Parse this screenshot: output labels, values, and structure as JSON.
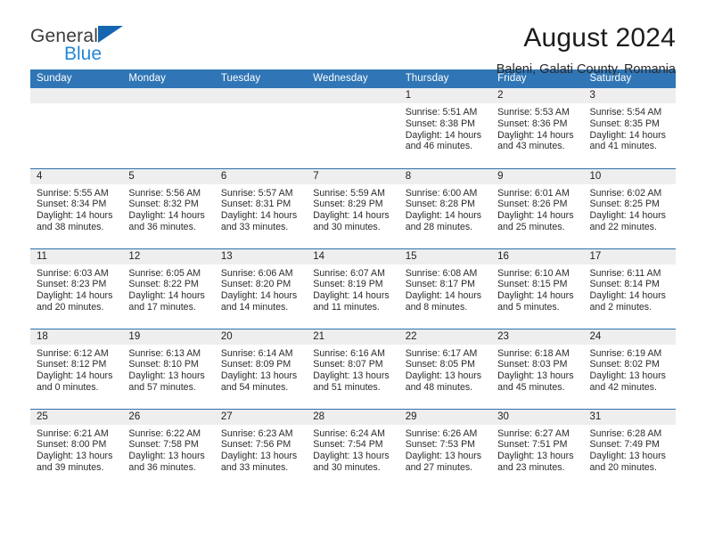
{
  "brand": {
    "line1": "General",
    "line2": "Blue",
    "triangle_color": "#1565b0",
    "line2_color": "#2287d6",
    "logo_icon": "general-blue-logo"
  },
  "header": {
    "title": "August 2024",
    "subtitle": "Baleni, Galati County, Romania"
  },
  "theme": {
    "header_blue": "#3076b6",
    "row_divider_blue": "#2f6fab",
    "daynum_band_grey": "#eeeeee",
    "text": "#2b2b2b"
  },
  "columns": [
    "Sunday",
    "Monday",
    "Tuesday",
    "Wednesday",
    "Thursday",
    "Friday",
    "Saturday"
  ],
  "labels": {
    "sunrise_prefix": "Sunrise:",
    "sunset_prefix": "Sunset:",
    "daylight_prefix": "Daylight:"
  },
  "weeks": [
    [
      {
        "day": "",
        "empty": true
      },
      {
        "day": "",
        "empty": true
      },
      {
        "day": "",
        "empty": true
      },
      {
        "day": "",
        "empty": true
      },
      {
        "day": "1",
        "sunrise": "Sunrise: 5:51 AM",
        "sunset": "Sunset: 8:38 PM",
        "daylight": "Daylight: 14 hours and 46 minutes."
      },
      {
        "day": "2",
        "sunrise": "Sunrise: 5:53 AM",
        "sunset": "Sunset: 8:36 PM",
        "daylight": "Daylight: 14 hours and 43 minutes."
      },
      {
        "day": "3",
        "sunrise": "Sunrise: 5:54 AM",
        "sunset": "Sunset: 8:35 PM",
        "daylight": "Daylight: 14 hours and 41 minutes."
      }
    ],
    [
      {
        "day": "4",
        "sunrise": "Sunrise: 5:55 AM",
        "sunset": "Sunset: 8:34 PM",
        "daylight": "Daylight: 14 hours and 38 minutes."
      },
      {
        "day": "5",
        "sunrise": "Sunrise: 5:56 AM",
        "sunset": "Sunset: 8:32 PM",
        "daylight": "Daylight: 14 hours and 36 minutes."
      },
      {
        "day": "6",
        "sunrise": "Sunrise: 5:57 AM",
        "sunset": "Sunset: 8:31 PM",
        "daylight": "Daylight: 14 hours and 33 minutes."
      },
      {
        "day": "7",
        "sunrise": "Sunrise: 5:59 AM",
        "sunset": "Sunset: 8:29 PM",
        "daylight": "Daylight: 14 hours and 30 minutes."
      },
      {
        "day": "8",
        "sunrise": "Sunrise: 6:00 AM",
        "sunset": "Sunset: 8:28 PM",
        "daylight": "Daylight: 14 hours and 28 minutes."
      },
      {
        "day": "9",
        "sunrise": "Sunrise: 6:01 AM",
        "sunset": "Sunset: 8:26 PM",
        "daylight": "Daylight: 14 hours and 25 minutes."
      },
      {
        "day": "10",
        "sunrise": "Sunrise: 6:02 AM",
        "sunset": "Sunset: 8:25 PM",
        "daylight": "Daylight: 14 hours and 22 minutes."
      }
    ],
    [
      {
        "day": "11",
        "sunrise": "Sunrise: 6:03 AM",
        "sunset": "Sunset: 8:23 PM",
        "daylight": "Daylight: 14 hours and 20 minutes."
      },
      {
        "day": "12",
        "sunrise": "Sunrise: 6:05 AM",
        "sunset": "Sunset: 8:22 PM",
        "daylight": "Daylight: 14 hours and 17 minutes."
      },
      {
        "day": "13",
        "sunrise": "Sunrise: 6:06 AM",
        "sunset": "Sunset: 8:20 PM",
        "daylight": "Daylight: 14 hours and 14 minutes."
      },
      {
        "day": "14",
        "sunrise": "Sunrise: 6:07 AM",
        "sunset": "Sunset: 8:19 PM",
        "daylight": "Daylight: 14 hours and 11 minutes."
      },
      {
        "day": "15",
        "sunrise": "Sunrise: 6:08 AM",
        "sunset": "Sunset: 8:17 PM",
        "daylight": "Daylight: 14 hours and 8 minutes."
      },
      {
        "day": "16",
        "sunrise": "Sunrise: 6:10 AM",
        "sunset": "Sunset: 8:15 PM",
        "daylight": "Daylight: 14 hours and 5 minutes."
      },
      {
        "day": "17",
        "sunrise": "Sunrise: 6:11 AM",
        "sunset": "Sunset: 8:14 PM",
        "daylight": "Daylight: 14 hours and 2 minutes."
      }
    ],
    [
      {
        "day": "18",
        "sunrise": "Sunrise: 6:12 AM",
        "sunset": "Sunset: 8:12 PM",
        "daylight": "Daylight: 14 hours and 0 minutes."
      },
      {
        "day": "19",
        "sunrise": "Sunrise: 6:13 AM",
        "sunset": "Sunset: 8:10 PM",
        "daylight": "Daylight: 13 hours and 57 minutes."
      },
      {
        "day": "20",
        "sunrise": "Sunrise: 6:14 AM",
        "sunset": "Sunset: 8:09 PM",
        "daylight": "Daylight: 13 hours and 54 minutes."
      },
      {
        "day": "21",
        "sunrise": "Sunrise: 6:16 AM",
        "sunset": "Sunset: 8:07 PM",
        "daylight": "Daylight: 13 hours and 51 minutes."
      },
      {
        "day": "22",
        "sunrise": "Sunrise: 6:17 AM",
        "sunset": "Sunset: 8:05 PM",
        "daylight": "Daylight: 13 hours and 48 minutes."
      },
      {
        "day": "23",
        "sunrise": "Sunrise: 6:18 AM",
        "sunset": "Sunset: 8:03 PM",
        "daylight": "Daylight: 13 hours and 45 minutes."
      },
      {
        "day": "24",
        "sunrise": "Sunrise: 6:19 AM",
        "sunset": "Sunset: 8:02 PM",
        "daylight": "Daylight: 13 hours and 42 minutes."
      }
    ],
    [
      {
        "day": "25",
        "sunrise": "Sunrise: 6:21 AM",
        "sunset": "Sunset: 8:00 PM",
        "daylight": "Daylight: 13 hours and 39 minutes."
      },
      {
        "day": "26",
        "sunrise": "Sunrise: 6:22 AM",
        "sunset": "Sunset: 7:58 PM",
        "daylight": "Daylight: 13 hours and 36 minutes."
      },
      {
        "day": "27",
        "sunrise": "Sunrise: 6:23 AM",
        "sunset": "Sunset: 7:56 PM",
        "daylight": "Daylight: 13 hours and 33 minutes."
      },
      {
        "day": "28",
        "sunrise": "Sunrise: 6:24 AM",
        "sunset": "Sunset: 7:54 PM",
        "daylight": "Daylight: 13 hours and 30 minutes."
      },
      {
        "day": "29",
        "sunrise": "Sunrise: 6:26 AM",
        "sunset": "Sunset: 7:53 PM",
        "daylight": "Daylight: 13 hours and 27 minutes."
      },
      {
        "day": "30",
        "sunrise": "Sunrise: 6:27 AM",
        "sunset": "Sunset: 7:51 PM",
        "daylight": "Daylight: 13 hours and 23 minutes."
      },
      {
        "day": "31",
        "sunrise": "Sunrise: 6:28 AM",
        "sunset": "Sunset: 7:49 PM",
        "daylight": "Daylight: 13 hours and 20 minutes."
      }
    ]
  ]
}
